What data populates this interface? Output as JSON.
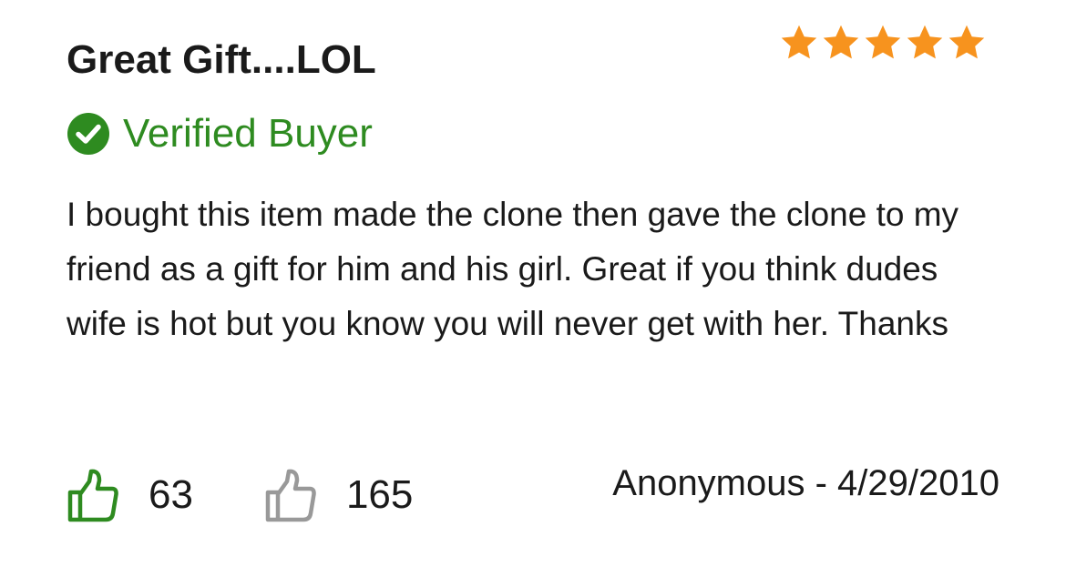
{
  "review": {
    "title": "Great Gift....LOL",
    "rating": 5,
    "rating_max": 5,
    "star_color": "#f7931e",
    "verified_label": "Verified Buyer",
    "verified_color": "#2e8b20",
    "verified_icon": "check-circle-icon",
    "body": "I bought this item made the clone then gave the clone to my friend as a gift for him and his girl. Great if you think dudes wife is hot but you know you will never get with her. Thanks",
    "helpful_count": "63",
    "helpful_icon": "thumbs-up-icon",
    "helpful_color": "#2e8b20",
    "unhelpful_count": "165",
    "unhelpful_icon": "thumbs-up-outline-icon",
    "unhelpful_color": "#999999",
    "author_date": "Anonymous - 4/29/2010"
  }
}
